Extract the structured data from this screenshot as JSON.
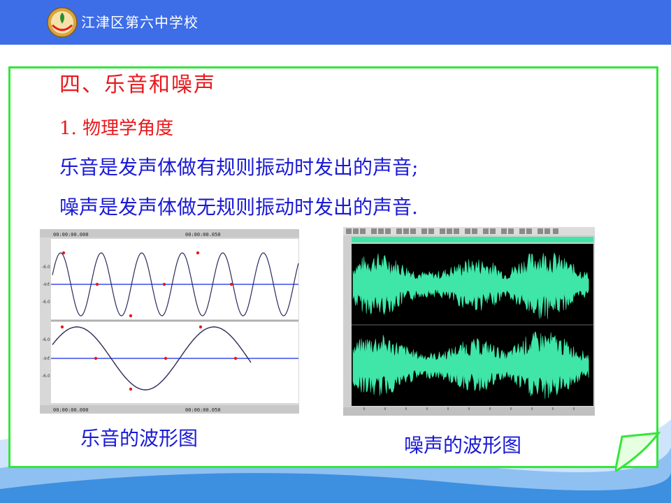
{
  "header": {
    "school_name": "江津区第六中学校",
    "bar_color": "#3d6ee8"
  },
  "slide": {
    "heading": "四、乐音和噪声",
    "subheading": "1. 物理学角度",
    "lines": [
      "乐音是发声体做有规则振动时发出的声音;",
      "噪声是发声体做无规则振动时发出的声音."
    ],
    "frame_color": "#33e63a",
    "heading_color": "#e8191d",
    "body_color": "#1a1ad6"
  },
  "figures": {
    "music": {
      "caption": "乐音的波形图",
      "time_start": "00:00:00.000",
      "time_mid": "00:00:00.050",
      "axis_labels": [
        "-6.0",
        "-Inf.",
        "-6.0"
      ]
    },
    "noise": {
      "caption": "噪声的波形图",
      "wave_color": "#3fe6a8",
      "background": "#000000"
    }
  }
}
